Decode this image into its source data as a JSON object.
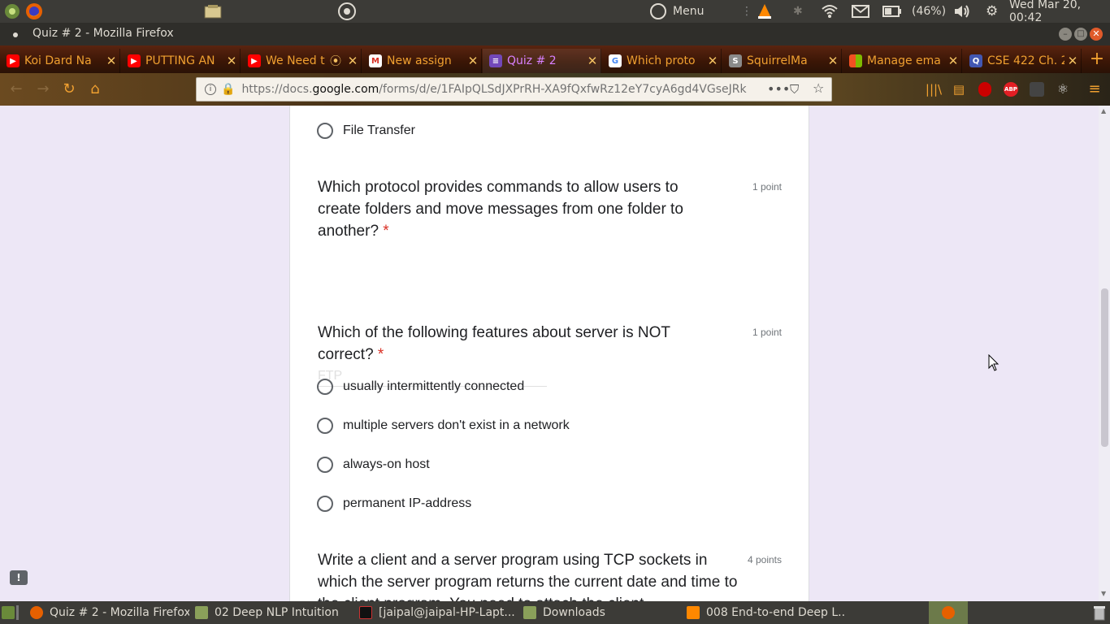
{
  "system_panel": {
    "menu_label": "Menu",
    "battery": "(46%)",
    "datetime": "Wed Mar 20, 00:42"
  },
  "window": {
    "title": "Quiz # 2 - Mozilla Firefox"
  },
  "tabs": [
    {
      "label": "Koi Dard Na",
      "icon": "youtube-icon",
      "color": "#ff0000"
    },
    {
      "label": "PUTTING AN",
      "icon": "youtube-icon",
      "color": "#ff0000"
    },
    {
      "label": "We Need t",
      "icon": "youtube-icon",
      "color": "#ff0000"
    },
    {
      "label": "New assign",
      "icon": "gmail-icon",
      "color": "#ffffff"
    },
    {
      "label": "Quiz # 2",
      "icon": "forms-icon",
      "color": "#7248b9"
    },
    {
      "label": "Which proto",
      "icon": "google-icon",
      "color": "#ffffff"
    },
    {
      "label": "SquirrelMa",
      "icon": "squirrelmail-icon",
      "color": "#8a8a8a"
    },
    {
      "label": "Manage ema",
      "icon": "microsoft-icon",
      "color": "#f25022"
    },
    {
      "label": "CSE 422 Ch. 2",
      "icon": "quizlet-icon",
      "color": "#4257b2"
    }
  ],
  "nav": {
    "url_prefix": "https://docs.",
    "url_domain": "google.com",
    "url_path": "/forms/d/e/1FAIpQLSdJXPrRH-XA9fQxfwRz12eY7cyA6gd4VGseJRk"
  },
  "form": {
    "q0_option": "File Transfer",
    "q1": {
      "text": "Which protocol provides commands to allow users to create folders and move messages from one folder to another?",
      "required": "*",
      "points": "1 point",
      "answer_placeholder": "FTP"
    },
    "q2": {
      "text": "Which of the following features about server is NOT correct?",
      "required": "*",
      "points": "1 point",
      "options": [
        "usually intermittently connected",
        "multiple servers don't exist in a network",
        "always-on host",
        "permanent IP-address"
      ]
    },
    "q3": {
      "text": "Write a client and a server program using TCP sockets in which the server program returns the current date and time to the client program. You need to attach the client",
      "points": "4 points"
    }
  },
  "taskbar": [
    {
      "label": "Quiz # 2 - Mozilla Firefox",
      "icon": "firefox-icon"
    },
    {
      "label": "02 Deep NLP Intuition",
      "icon": "folder-icon"
    },
    {
      "label": "[jaipal@jaipal-HP-Lapt...",
      "icon": "terminal-icon"
    },
    {
      "label": "Downloads",
      "icon": "folder-icon"
    },
    {
      "label": "008 End-to-end Deep L...",
      "icon": "vlc-icon"
    }
  ]
}
